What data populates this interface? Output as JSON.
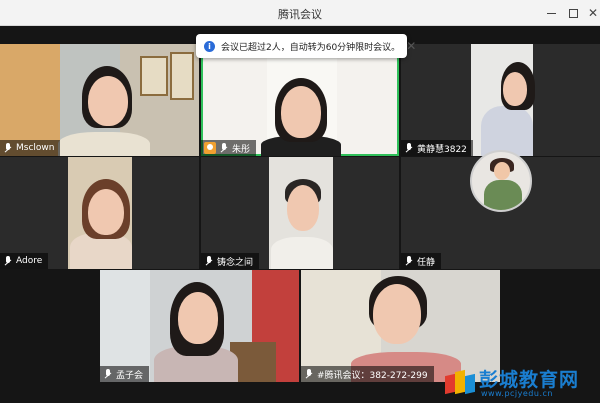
{
  "window": {
    "title": "腾讯会议"
  },
  "notice": {
    "message": "会议已超过2人，自动转为60分钟限时会议。"
  },
  "participants": [
    {
      "name": "Msclown"
    },
    {
      "name": "朱彤"
    },
    {
      "name": "黄静慧3822"
    },
    {
      "name": "Adore"
    },
    {
      "name": "铸念之间"
    },
    {
      "name": "任静"
    },
    {
      "name": "孟子会"
    },
    {
      "name": "#腾讯会议：382-272-299"
    }
  ],
  "watermark": {
    "brand": "彭城教育网",
    "url": "www.pcjyedu.cn"
  },
  "colors": {
    "active_speaker_border": "#2fc05a",
    "notice_icon": "#2a6bd8",
    "brand": "#1a7ed0"
  }
}
